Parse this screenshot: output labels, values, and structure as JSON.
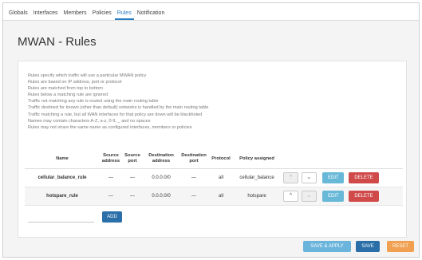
{
  "nav": {
    "tabs": [
      {
        "label": "Globals"
      },
      {
        "label": "Interfaces"
      },
      {
        "label": "Members"
      },
      {
        "label": "Policies"
      },
      {
        "label": "Rules"
      },
      {
        "label": "Notification"
      }
    ],
    "active": "Rules"
  },
  "page": {
    "title": "MWAN - Rules"
  },
  "description": [
    "Rules specify which traffic will use a particular MWAN policy",
    "Rules are based on IP address, port or protocol",
    "Rules are matched from top to bottom",
    "Rules below a matching rule are ignored",
    "Traffic not matching any rule is routed using the main routing table",
    "Traffic destined for known (other than default) networks is handled by the main routing table",
    "Traffic matching a rule, but all WAN interfaces for that policy are down will be blackholed",
    "Names may contain characters A-Z, a-z, 0-9, _ and no spaces",
    "Rules may not share the same name as configured interfaces, members or policies"
  ],
  "table": {
    "headers": {
      "name": "Name",
      "src_addr": "Source address",
      "src_port": "Source port",
      "dst_addr": "Destination address",
      "dst_port": "Destination port",
      "protocol": "Protocol",
      "policy": "Policy assigned"
    },
    "rows": [
      {
        "name": "cellular_balance_rule",
        "src_addr": "—",
        "src_port": "—",
        "dst_addr": "0.0.0.0/0",
        "dst_port": "—",
        "protocol": "all",
        "policy": "cellular_balance",
        "up_disabled": true,
        "down_disabled": false
      },
      {
        "name": "hotspare_rule",
        "src_addr": "—",
        "src_port": "—",
        "dst_addr": "0.0.0.0/0",
        "dst_port": "—",
        "protocol": "all",
        "policy": "hotspare",
        "up_disabled": false,
        "down_disabled": true
      }
    ],
    "buttons": {
      "up": "^",
      "down": "⌄",
      "edit": "EDIT",
      "delete": "DELETE"
    }
  },
  "add": {
    "value": "",
    "button": "ADD"
  },
  "footer": {
    "save_apply": "SAVE & APPLY",
    "save": "SAVE",
    "reset": "RESET"
  },
  "colors": {
    "accent": "#2a7fc4",
    "edit": "#68b8d8",
    "delete": "#d04a4a",
    "save": "#2a6fa8",
    "save_apply": "#6bb4dc",
    "reset": "#f0a050"
  }
}
